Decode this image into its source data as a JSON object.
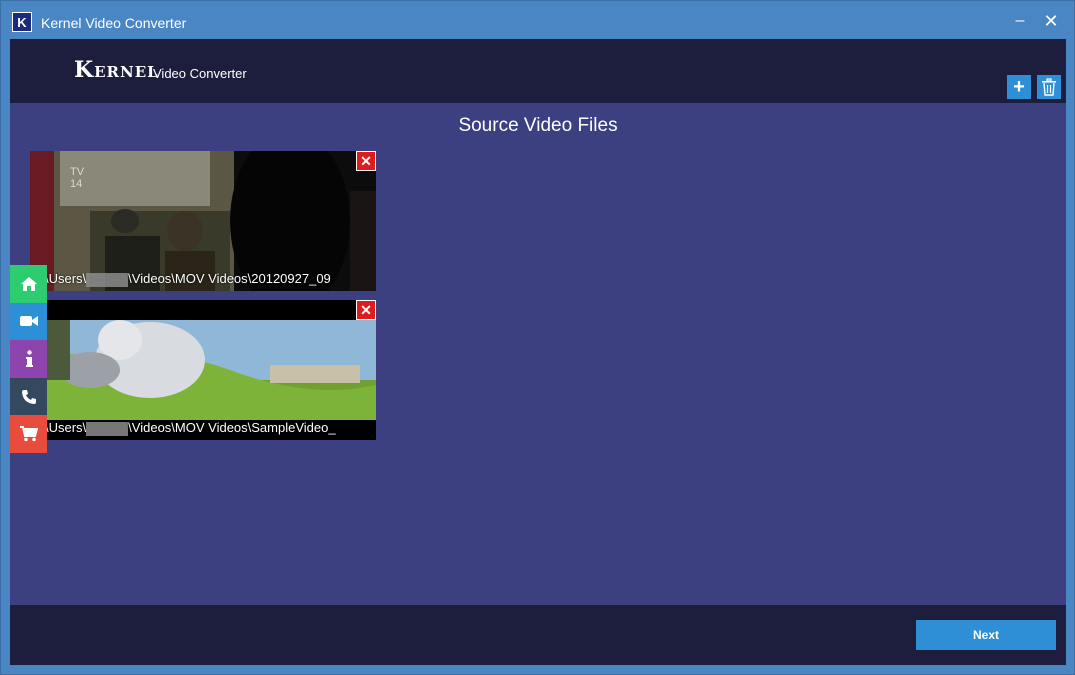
{
  "window": {
    "title": "Kernel Video Converter",
    "icon_letter": "K",
    "minimize_glyph": "–",
    "close_glyph": "✕"
  },
  "header": {
    "brand_name": "Kernel",
    "product_name": "Video Converter",
    "add_glyph": "+",
    "add_icon": "plus-icon",
    "delete_icon": "trash-icon"
  },
  "main": {
    "title": "Source Video Files",
    "files": [
      {
        "path_prefix": "C:\\Users\\",
        "path_suffix": "\\Videos\\MOV Videos\\20120927_09",
        "remove_glyph": "✕"
      },
      {
        "path_prefix": "C:\\Users\\",
        "path_suffix": "\\Videos\\MOV Videos\\SampleVideo_",
        "remove_glyph": "✕"
      }
    ]
  },
  "side_nav": [
    "home-icon",
    "video-camera-icon",
    "info-icon",
    "phone-icon",
    "cart-icon"
  ],
  "footer": {
    "next_label": "Next"
  },
  "colors": {
    "titlebar": "#4a86c4",
    "header_bg": "#1d1e3d",
    "main_bg": "#3c4080",
    "accent": "#2e8fd6",
    "remove_red": "#e01b1b"
  }
}
